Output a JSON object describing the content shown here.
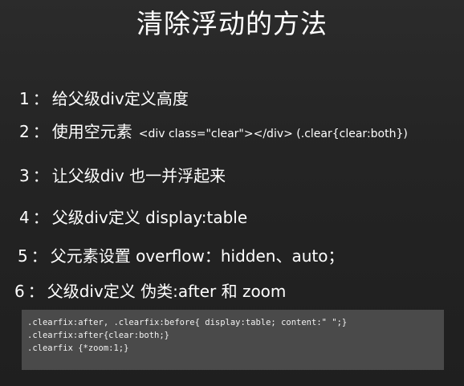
{
  "title": "清除浮动的方法",
  "items": [
    {
      "num": "1",
      "sep": "：",
      "text": "给父级div定义高度"
    },
    {
      "num": "2",
      "sep": "：",
      "text": "使用空元素",
      "code": "<div class=\"clear\"></div> (.clear{clear:both})"
    },
    {
      "num": "3",
      "sep": "：",
      "text": "让父级div 也一并浮起来"
    },
    {
      "num": "4",
      "sep": "：",
      "text": "父级div定义 display:table"
    },
    {
      "num": "5",
      "sep": "：",
      "text": "父元素设置 overflow：hidden、auto；"
    },
    {
      "num": "6",
      "sep": "：",
      "text": "父级div定义 伪类:after 和 zoom"
    }
  ],
  "code_lines": [
    ".clearfix:after, .clearfix:before{ display:table; content:\" \";}",
    ".clearfix:after{clear:both;}",
    ".clearfix {*zoom:1;}"
  ],
  "colors": {
    "background": "#252525",
    "text": "#ffffff",
    "codebox": "#4a4a4a"
  }
}
